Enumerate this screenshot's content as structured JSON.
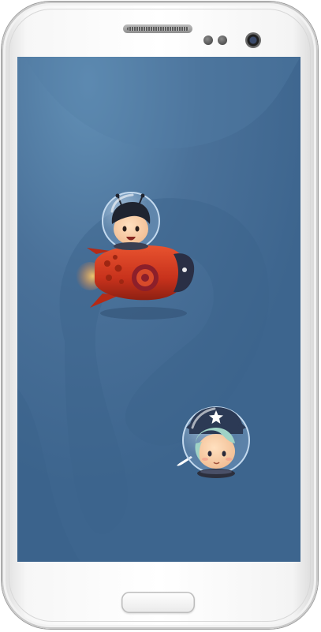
{
  "device": {
    "model": "android-phone",
    "body_color": "#f4f4f4",
    "screen_color": "#4a7199"
  },
  "game": {
    "background": {
      "base_color": "#4a7199",
      "swirl_color": "#3f6690"
    },
    "characters": [
      {
        "id": "pilot-boy",
        "vehicle": "red-rocket",
        "helmet": "glass-bubble",
        "hair_color": "#1f2430",
        "rocket_color": "#c8321c",
        "target_color": "#8c1f2a"
      },
      {
        "id": "astronaut-girl",
        "vehicle": "none",
        "helmet": "glass-bubble",
        "hat_color": "#2c3a55",
        "hair_color": "#9fd3c6",
        "hat_badge": "star"
      }
    ]
  },
  "icons": {
    "speaker": "speaker-grille-icon",
    "camera": "front-camera-icon",
    "sensors": "proximity-sensor-icon",
    "home": "home-button-icon"
  }
}
